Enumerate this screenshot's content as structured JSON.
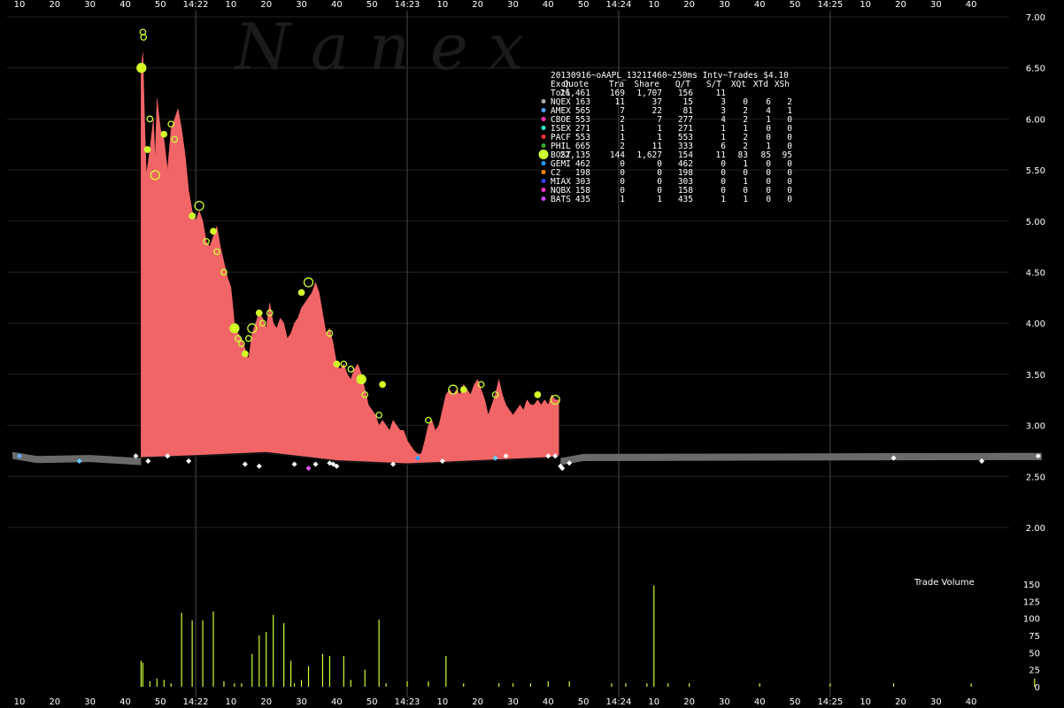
{
  "chart_data": {
    "type": "area",
    "title": "20130916~oAAPL_1321I460~250ms Intv~Trades $4.10",
    "watermark": "Nanex",
    "volume_label": "Trade Volume",
    "colors": {
      "area_fill": "#f26566",
      "gray_band": "#6a6a6a",
      "trade_marker": "#ccff33",
      "white_marker": "#ffffff",
      "grid": "#3a3a3a"
    },
    "price_axis": {
      "ylim": [
        2.0,
        7.0
      ],
      "ticks": [
        "7.00",
        "6.50",
        "6.00",
        "5.50",
        "5.00",
        "4.50",
        "4.00",
        "3.50",
        "3.00",
        "2.50",
        "2.00"
      ],
      "tick_values": [
        7.0,
        6.5,
        6.0,
        5.5,
        5.0,
        4.5,
        4.0,
        3.5,
        3.0,
        2.5,
        2.0
      ]
    },
    "volume_axis": {
      "ylim": [
        0,
        150
      ],
      "ticks": [
        "150",
        "125",
        "100",
        "75",
        "50",
        "25",
        "0"
      ],
      "tick_values": [
        150,
        125,
        100,
        75,
        50,
        25,
        0
      ]
    },
    "x_axis": {
      "start_seconds": 8,
      "end_seconds": 300,
      "labels": [
        "10",
        "20",
        "30",
        "40",
        "50",
        "14:22",
        "10",
        "20",
        "30",
        "40",
        "50",
        "14:23",
        "10",
        "20",
        "30",
        "40",
        "50",
        "14:24",
        "10",
        "20",
        "30",
        "40",
        "50",
        "14:25",
        "10",
        "20",
        "30",
        "40"
      ],
      "label_seconds": [
        10,
        20,
        30,
        40,
        50,
        60,
        70,
        80,
        90,
        100,
        110,
        120,
        130,
        140,
        150,
        160,
        170,
        180,
        190,
        200,
        210,
        220,
        230,
        240,
        250,
        260,
        270,
        280
      ],
      "minute_lines": [
        60,
        120,
        180,
        240
      ]
    },
    "ask_series": {
      "name": "",
      "points": [
        [
          44.5,
          6.5
        ],
        [
          45,
          6.65
        ],
        [
          45.5,
          6.0
        ],
        [
          46,
          5.45
        ],
        [
          47,
          5.7
        ],
        [
          48,
          6.0
        ],
        [
          48.5,
          5.6
        ],
        [
          49,
          6.2
        ],
        [
          50,
          5.9
        ],
        [
          51,
          5.8
        ],
        [
          52,
          5.5
        ],
        [
          53,
          5.9
        ],
        [
          54,
          6.0
        ],
        [
          55,
          6.1
        ],
        [
          56,
          5.9
        ],
        [
          57,
          5.65
        ],
        [
          58,
          5.3
        ],
        [
          59,
          5.1
        ],
        [
          60,
          5.0
        ],
        [
          61,
          5.1
        ],
        [
          62,
          5.0
        ],
        [
          63,
          4.8
        ],
        [
          64,
          4.75
        ],
        [
          65,
          4.85
        ],
        [
          66,
          4.95
        ],
        [
          67,
          4.75
        ],
        [
          68,
          4.6
        ],
        [
          69,
          4.45
        ],
        [
          70,
          4.35
        ],
        [
          71,
          4.0
        ],
        [
          72,
          3.9
        ],
        [
          73,
          3.85
        ],
        [
          74,
          3.75
        ],
        [
          75,
          3.65
        ],
        [
          76,
          3.9
        ],
        [
          77,
          4.0
        ],
        [
          78,
          4.1
        ],
        [
          79,
          4.05
        ],
        [
          80,
          3.95
        ],
        [
          81,
          4.2
        ],
        [
          82,
          4.0
        ],
        [
          83,
          3.95
        ],
        [
          84,
          4.05
        ],
        [
          85,
          4.0
        ],
        [
          86,
          3.85
        ],
        [
          87,
          3.9
        ],
        [
          88,
          4.0
        ],
        [
          89,
          4.05
        ],
        [
          90,
          4.15
        ],
        [
          91,
          4.2
        ],
        [
          92,
          4.25
        ],
        [
          93,
          4.3
        ],
        [
          94,
          4.4
        ],
        [
          95,
          4.3
        ],
        [
          96,
          4.1
        ],
        [
          97,
          3.9
        ],
        [
          98,
          3.95
        ],
        [
          99,
          3.8
        ],
        [
          100,
          3.6
        ],
        [
          101,
          3.55
        ],
        [
          102,
          3.6
        ],
        [
          103,
          3.5
        ],
        [
          104,
          3.45
        ],
        [
          105,
          3.55
        ],
        [
          106,
          3.6
        ],
        [
          107,
          3.5
        ],
        [
          108,
          3.35
        ],
        [
          109,
          3.2
        ],
        [
          110,
          3.15
        ],
        [
          111,
          3.1
        ],
        [
          112,
          3.0
        ],
        [
          113,
          3.05
        ],
        [
          114,
          3.0
        ],
        [
          115,
          2.95
        ],
        [
          116,
          3.05
        ],
        [
          117,
          3.0
        ],
        [
          118,
          2.95
        ],
        [
          119,
          2.95
        ],
        [
          120,
          2.85
        ],
        [
          121,
          2.8
        ],
        [
          122,
          2.75
        ],
        [
          123,
          2.72
        ],
        [
          124,
          2.72
        ],
        [
          125,
          2.85
        ],
        [
          126,
          3.0
        ],
        [
          127,
          3.05
        ],
        [
          128,
          2.95
        ],
        [
          129,
          3.0
        ],
        [
          130,
          3.15
        ],
        [
          131,
          3.3
        ],
        [
          132,
          3.35
        ],
        [
          133,
          3.3
        ],
        [
          134,
          3.35
        ],
        [
          135,
          3.3
        ],
        [
          136,
          3.4
        ],
        [
          137,
          3.35
        ],
        [
          138,
          3.3
        ],
        [
          139,
          3.4
        ],
        [
          140,
          3.45
        ],
        [
          141,
          3.35
        ],
        [
          142,
          3.25
        ],
        [
          143,
          3.1
        ],
        [
          144,
          3.2
        ],
        [
          145,
          3.3
        ],
        [
          146,
          3.45
        ],
        [
          147,
          3.3
        ],
        [
          148,
          3.2
        ],
        [
          149,
          3.15
        ],
        [
          150,
          3.1
        ],
        [
          151,
          3.15
        ],
        [
          152,
          3.2
        ],
        [
          153,
          3.15
        ],
        [
          154,
          3.25
        ],
        [
          155,
          3.2
        ],
        [
          156,
          3.2
        ],
        [
          157,
          3.25
        ],
        [
          158,
          3.2
        ],
        [
          159,
          3.25
        ],
        [
          160,
          3.2
        ],
        [
          161,
          3.3
        ],
        [
          162,
          3.25
        ],
        [
          163,
          3.25
        ]
      ],
      "bid_points": [
        [
          44.5,
          2.68
        ],
        [
          60,
          2.7
        ],
        [
          80,
          2.73
        ],
        [
          100,
          2.65
        ],
        [
          120,
          2.62
        ],
        [
          140,
          2.65
        ],
        [
          160,
          2.68
        ],
        [
          163,
          2.7
        ]
      ]
    },
    "gray_band": {
      "left": [
        [
          8,
          2.72
        ],
        [
          15,
          2.68
        ],
        [
          30,
          2.69
        ],
        [
          44.5,
          2.66
        ]
      ],
      "right": [
        [
          163.5,
          2.66
        ],
        [
          170,
          2.7
        ],
        [
          290,
          2.71
        ],
        [
          300,
          2.71
        ]
      ]
    },
    "trades_lime": [
      [
        44.6,
        6.5
      ],
      [
        45,
        6.85
      ],
      [
        45.2,
        6.8
      ],
      [
        46.3,
        5.7
      ],
      [
        47,
        6.0
      ],
      [
        48.5,
        5.45
      ],
      [
        51,
        5.85
      ],
      [
        53,
        5.95
      ],
      [
        54,
        5.8
      ],
      [
        59,
        5.05
      ],
      [
        61,
        5.15
      ],
      [
        63,
        4.8
      ],
      [
        65,
        4.9
      ],
      [
        66,
        4.7
      ],
      [
        68,
        4.5
      ],
      [
        71,
        3.95
      ],
      [
        72,
        3.85
      ],
      [
        73,
        3.8
      ],
      [
        74,
        3.7
      ],
      [
        75,
        3.85
      ],
      [
        76,
        3.95
      ],
      [
        78,
        4.1
      ],
      [
        79,
        4.0
      ],
      [
        81,
        4.1
      ],
      [
        90,
        4.3
      ],
      [
        92,
        4.4
      ],
      [
        98,
        3.9
      ],
      [
        100,
        3.6
      ],
      [
        102,
        3.6
      ],
      [
        104,
        3.55
      ],
      [
        107,
        3.45
      ],
      [
        108,
        3.3
      ],
      [
        112,
        3.1
      ],
      [
        113,
        3.4
      ],
      [
        126,
        3.05
      ],
      [
        133,
        3.35
      ],
      [
        136,
        3.35
      ],
      [
        141,
        3.4
      ],
      [
        145,
        3.3
      ],
      [
        157,
        3.3
      ],
      [
        162,
        3.25
      ]
    ],
    "trades_white": [
      [
        43,
        2.7
      ],
      [
        46.5,
        2.65
      ],
      [
        52,
        2.7
      ],
      [
        58,
        2.65
      ],
      [
        74,
        2.62
      ],
      [
        78,
        2.6
      ],
      [
        88,
        2.62
      ],
      [
        94,
        2.62
      ],
      [
        98,
        2.63
      ],
      [
        99,
        2.62
      ],
      [
        100,
        2.6
      ],
      [
        116,
        2.62
      ],
      [
        130,
        2.65
      ],
      [
        148,
        2.7
      ],
      [
        160,
        2.7
      ],
      [
        162,
        2.7
      ],
      [
        163.5,
        2.6
      ],
      [
        164,
        2.58
      ],
      [
        166,
        2.63
      ],
      [
        258,
        2.68
      ],
      [
        283,
        2.65
      ],
      [
        299,
        2.7
      ]
    ],
    "trades_other": [
      [
        10,
        2.7,
        "#66aaff"
      ],
      [
        27,
        2.65,
        "#66ccff"
      ],
      [
        92,
        2.58,
        "#dd55ff"
      ],
      [
        123,
        2.68,
        "#3399ff"
      ],
      [
        145,
        2.68,
        "#66ccff"
      ]
    ],
    "volume_bars": [
      [
        44.5,
        38
      ],
      [
        45,
        35
      ],
      [
        47,
        8
      ],
      [
        49,
        12
      ],
      [
        51,
        10
      ],
      [
        53,
        5
      ],
      [
        56,
        108
      ],
      [
        59,
        97
      ],
      [
        62,
        97
      ],
      [
        65,
        110
      ],
      [
        68,
        8
      ],
      [
        71,
        5
      ],
      [
        73,
        5
      ],
      [
        76,
        48
      ],
      [
        78,
        75
      ],
      [
        80,
        80
      ],
      [
        82,
        105
      ],
      [
        85,
        93
      ],
      [
        87,
        38
      ],
      [
        88,
        5
      ],
      [
        90,
        10
      ],
      [
        92,
        30
      ],
      [
        96,
        48
      ],
      [
        98,
        45
      ],
      [
        102,
        45
      ],
      [
        104,
        10
      ],
      [
        108,
        25
      ],
      [
        112,
        98
      ],
      [
        114,
        5
      ],
      [
        120,
        8
      ],
      [
        126,
        8
      ],
      [
        131,
        45
      ],
      [
        136,
        5
      ],
      [
        146,
        5
      ],
      [
        150,
        5
      ],
      [
        155,
        5
      ],
      [
        160,
        8
      ],
      [
        166,
        8
      ],
      [
        178,
        5
      ],
      [
        182,
        5
      ],
      [
        188,
        5
      ],
      [
        190,
        148
      ],
      [
        194,
        5
      ],
      [
        200,
        5
      ],
      [
        220,
        5
      ],
      [
        240,
        5
      ],
      [
        258,
        5
      ],
      [
        280,
        5
      ],
      [
        298,
        12
      ]
    ]
  },
  "stats_table": {
    "header": [
      "Exch",
      "Quote",
      "Tra",
      "Share",
      "Q/T",
      "S/T",
      "XQt",
      "XTd",
      "XSh"
    ],
    "total": [
      "Totl",
      "26,461",
      "169",
      "1,707",
      "156",
      "11",
      "",
      "",
      ""
    ],
    "rows": [
      {
        "marker_color": "#aaaaaa",
        "cells": [
          "NQEX",
          "163",
          "11",
          "37",
          "15",
          "3",
          "0",
          "6",
          "2"
        ]
      },
      {
        "marker_color": "#4aa3ff",
        "cells": [
          "AMEX",
          "565",
          "7",
          "22",
          "81",
          "3",
          "2",
          "4",
          "1"
        ]
      },
      {
        "marker_color": "#ff33aa",
        "cells": [
          "CBOE",
          "553",
          "2",
          "7",
          "277",
          "4",
          "2",
          "1",
          "0"
        ]
      },
      {
        "marker_color": "#33ffcc",
        "cells": [
          "ISEX",
          "271",
          "1",
          "1",
          "271",
          "1",
          "1",
          "0",
          "0"
        ]
      },
      {
        "marker_color": "#ff3333",
        "cells": [
          "PACF",
          "553",
          "1",
          "1",
          "553",
          "1",
          "2",
          "0",
          "0"
        ]
      },
      {
        "marker_color": "#33aa33",
        "cells": [
          "PHIL",
          "665",
          "2",
          "11",
          "333",
          "6",
          "2",
          "1",
          "0"
        ]
      },
      {
        "marker_color": "#ccff33",
        "cells": [
          "BOST",
          "22,135",
          "144",
          "1,627",
          "154",
          "11",
          "83",
          "85",
          "95"
        ]
      },
      {
        "marker_color": "#2299ff",
        "cells": [
          "GEMI",
          "462",
          "0",
          "0",
          "462",
          "0",
          "1",
          "0",
          "0"
        ]
      },
      {
        "marker_color": "#ff8800",
        "cells": [
          "C2",
          "198",
          "0",
          "0",
          "198",
          "0",
          "0",
          "0",
          "0"
        ]
      },
      {
        "marker_color": "#3344ff",
        "cells": [
          "MIAX",
          "303",
          "0",
          "0",
          "303",
          "0",
          "1",
          "0",
          "0"
        ]
      },
      {
        "marker_color": "#ff33cc",
        "cells": [
          "NQBX",
          "158",
          "0",
          "0",
          "158",
          "0",
          "0",
          "0",
          "0"
        ]
      },
      {
        "marker_color": "#cc44ff",
        "cells": [
          "BATS",
          "435",
          "1",
          "1",
          "435",
          "1",
          "1",
          "0",
          "0"
        ]
      }
    ]
  }
}
